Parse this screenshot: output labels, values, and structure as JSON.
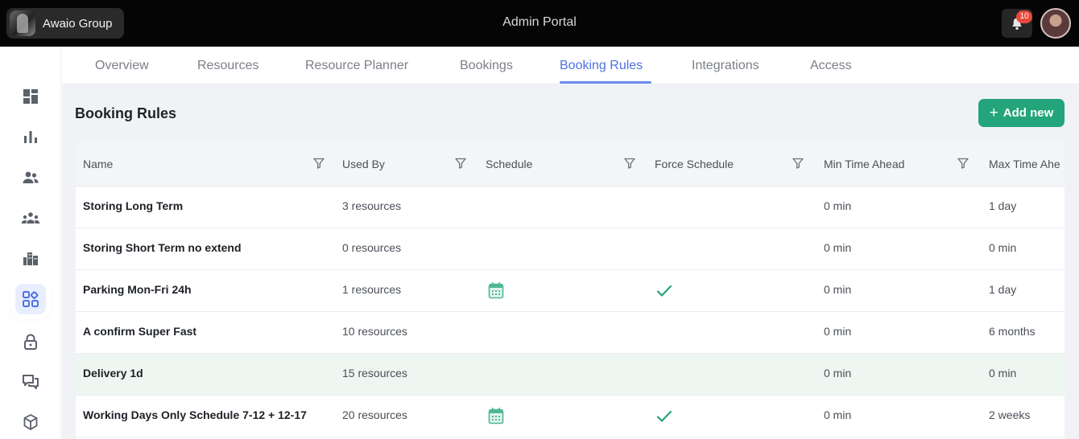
{
  "header": {
    "org_name": "Awaio Group",
    "title": "Admin Portal",
    "notification_count": "10"
  },
  "sidebar": {
    "items": [
      {
        "icon": "dashboard-icon"
      },
      {
        "icon": "bar-chart-icon"
      },
      {
        "icon": "users-icon"
      },
      {
        "icon": "groups-icon"
      },
      {
        "icon": "buildings-icon"
      },
      {
        "icon": "apps-icon",
        "active": true
      },
      {
        "icon": "lock-icon"
      },
      {
        "icon": "chat-icon"
      },
      {
        "icon": "package-icon"
      }
    ]
  },
  "tabs": [
    {
      "label": "Overview"
    },
    {
      "label": "Resources"
    },
    {
      "label": "Resource Planner"
    },
    {
      "label": "Bookings"
    },
    {
      "label": "Booking Rules",
      "active": true
    },
    {
      "label": "Integrations"
    },
    {
      "label": "Access"
    }
  ],
  "page": {
    "title": "Booking Rules",
    "add_button": "Add new"
  },
  "table": {
    "columns": [
      "Name",
      "Used By",
      "Schedule",
      "Force Schedule",
      "Min Time Ahead",
      "Max Time Ahe"
    ],
    "rows": [
      {
        "name": "Storing Long Term",
        "used_by": "3 resources",
        "schedule": false,
        "force": false,
        "min": "0 min",
        "max": "1 day"
      },
      {
        "name": "Storing Short Term no extend",
        "used_by": "0 resources",
        "schedule": false,
        "force": false,
        "min": "0 min",
        "max": "0 min"
      },
      {
        "name": "Parking Mon-Fri 24h",
        "used_by": "1 resources",
        "schedule": true,
        "force": true,
        "min": "0 min",
        "max": "1 day"
      },
      {
        "name": "A confirm Super Fast",
        "used_by": "10 resources",
        "schedule": false,
        "force": false,
        "min": "0 min",
        "max": "6 months"
      },
      {
        "name": "Delivery 1d",
        "used_by": "15 resources",
        "schedule": false,
        "force": false,
        "min": "0 min",
        "max": "0 min",
        "highlighted": true
      },
      {
        "name": "Working Days Only Schedule 7-12 + 12-17",
        "used_by": "20 resources",
        "schedule": true,
        "force": true,
        "min": "0 min",
        "max": "2 weeks"
      }
    ]
  },
  "colors": {
    "accent": "#4f72e3",
    "primary_button": "#23a47a",
    "check": "#23a47a",
    "calendar": "#4cb98f",
    "badge": "#e84a3a"
  }
}
